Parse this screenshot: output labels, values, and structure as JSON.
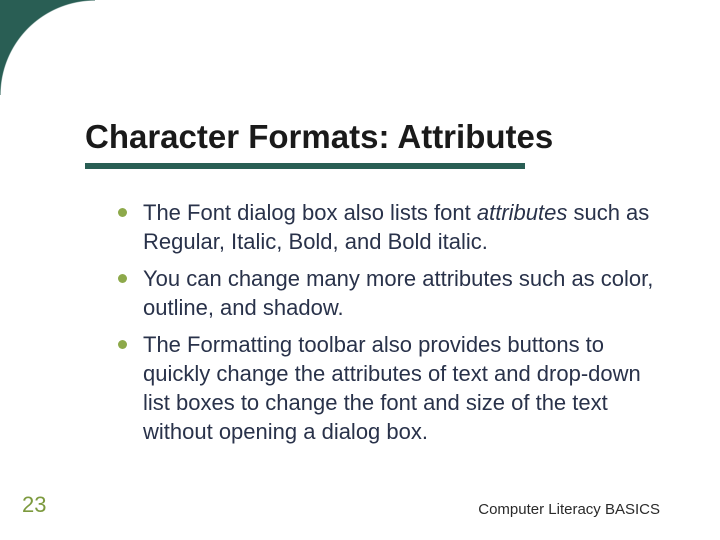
{
  "title": "Character Formats: Attributes",
  "bullets": [
    {
      "pre": "The Font dialog box also lists font ",
      "em": "attributes",
      "post": " such as Regular, Italic, Bold, and Bold italic."
    },
    {
      "pre": "You can change many more attributes such as color, outline, and shadow.",
      "em": "",
      "post": ""
    },
    {
      "pre": "The Formatting toolbar also provides buttons to quickly change the attributes of text and drop-down list boxes to change the font and size of the text without opening a dialog box.",
      "em": "",
      "post": ""
    }
  ],
  "page_number": "23",
  "footer": "Computer Literacy BASICS",
  "colors": {
    "accent": "#295e54",
    "bullet": "#8da94a",
    "pagenum": "#7c9a3e",
    "body": "#29324a"
  }
}
